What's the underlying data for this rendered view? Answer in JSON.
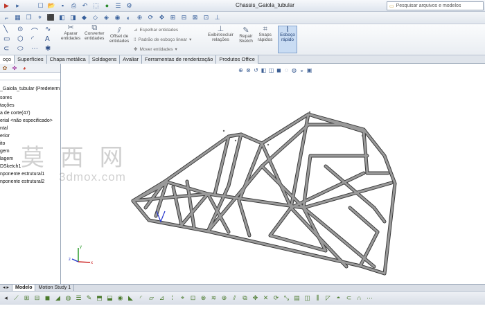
{
  "window": {
    "title": "Chassis_Gaiola_tubular",
    "search_placeholder": "Pesquisar arquivos e modelos"
  },
  "command_manager": {
    "aparar_label": "Aparar\nentidades",
    "converter_label": "Converter\nentidades",
    "offset_label": "Offset de\nentidades",
    "espelhar_label": "Espelhar entidades",
    "padrao_label": "Padrão de esboço linear",
    "mover_label": "Mover entidades",
    "exibir_label": "Exibir/excluir\nrelações",
    "repair_label": "Repair\nSketch",
    "snaps_label": "Snaps\nrápidos",
    "esboco_label": "Esboço\nrápido"
  },
  "tabs": [
    "oço",
    "Superfícies",
    "Chapa metálica",
    "Soldagens",
    "Avaliar",
    "Ferramentas de renderização",
    "Produtos Office"
  ],
  "feature_tree": [
    "_Gaiola_tubular  (Predeterm",
    "sores",
    "tações",
    "a de corte(47)",
    "erial <não especificado>",
    "ntal",
    "erior",
    "ito",
    "gem",
    "lagem",
    "DSketch1",
    "nponente estrutural1",
    "nponente estrutural2"
  ],
  "bottom_tabs": [
    "Modelo",
    "Motion Study 1"
  ],
  "watermark": {
    "text": "莫 西 网",
    "url": "3dmox.com"
  },
  "triad": {
    "x": "x",
    "y": "y",
    "z": "z"
  },
  "colors": {
    "tube": "#9a9a9a",
    "tube_edge": "#3c3c3c",
    "active_tab": "#ffffff"
  }
}
